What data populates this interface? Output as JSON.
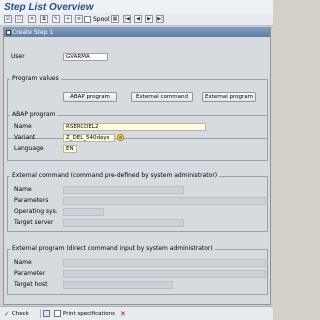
{
  "window": {
    "title": "Step List Overview"
  },
  "toolbar": {
    "spool_label": "Spool",
    "nav_first": "|◀",
    "nav_prev": "◀",
    "nav_next": "▶",
    "nav_last": "▶|"
  },
  "dialog": {
    "title": "Create Step 1",
    "user_label": "User",
    "user_value": "GVARMA",
    "program_values": {
      "title": "Program values",
      "abap_button": "ABAP program",
      "external_command_button": "External command",
      "external_program_button": "External program"
    },
    "abap": {
      "title": "ABAP program",
      "name_label": "Name",
      "name_value": "RSERCDEL2",
      "variant_label": "Variant",
      "variant_value": "Z_DEL_540days",
      "language_label": "Language",
      "language_value": "EN"
    },
    "external_command": {
      "title": "External command (command pre-defined by system administrator)",
      "name_label": "Name",
      "parameters_label": "Parameters",
      "os_label": "Operating sys.",
      "target_label": "Target server"
    },
    "external_program": {
      "title": "External program (direct command input by system administrator)",
      "name_label": "Name",
      "parameter_label": "Parameter",
      "target_label": "Target host"
    }
  },
  "footer": {
    "check_label": "Check",
    "print_label": "Print specifications"
  }
}
